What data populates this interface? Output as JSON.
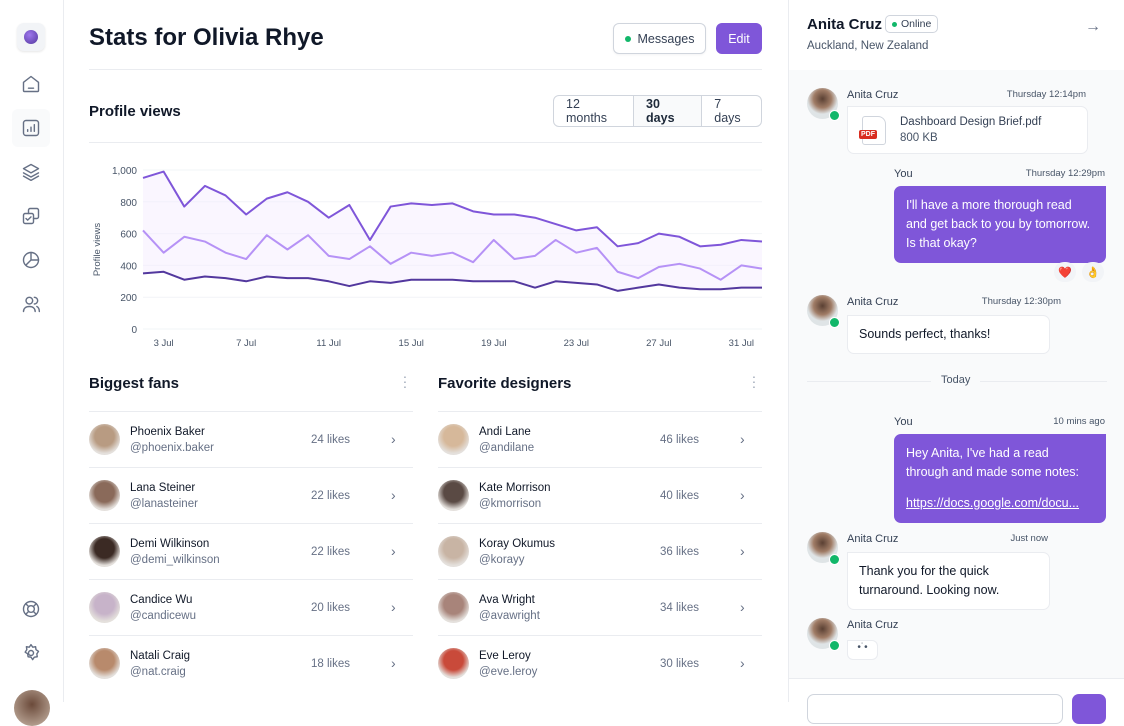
{
  "sidebar": {
    "items": [
      {
        "icon": "home-icon"
      },
      {
        "icon": "bar-chart-icon",
        "active": true
      },
      {
        "icon": "layers-icon"
      },
      {
        "icon": "check-square-icon"
      },
      {
        "icon": "pie-chart-icon"
      },
      {
        "icon": "users-icon"
      }
    ],
    "bottom": [
      {
        "icon": "life-buoy-icon"
      },
      {
        "icon": "settings-icon"
      }
    ]
  },
  "header": {
    "title": "Stats for Olivia Rhye",
    "messages_label": "Messages",
    "edit_label": "Edit"
  },
  "profile_views": {
    "title": "Profile views",
    "ranges": [
      "12 months",
      "30 days",
      "7 days"
    ],
    "selected_range": "30 days"
  },
  "chart_data": {
    "type": "line",
    "title": "",
    "xlabel": "",
    "ylabel": "Profile views",
    "ylim": [
      0,
      1000
    ],
    "yticks": [
      "0",
      "200",
      "400",
      "600",
      "800",
      "1,000"
    ],
    "xticks": [
      "3 Jul",
      "7 Jul",
      "11 Jul",
      "15 Jul",
      "19 Jul",
      "23 Jul",
      "27 Jul",
      "31 Jul"
    ],
    "grid": true,
    "colors": [
      "#7F56D9",
      "#B692F6",
      "#53389E"
    ],
    "x": [
      "2 Jul",
      "3 Jul",
      "4 Jul",
      "5 Jul",
      "6 Jul",
      "7 Jul",
      "8 Jul",
      "9 Jul",
      "10 Jul",
      "11 Jul",
      "12 Jul",
      "13 Jul",
      "14 Jul",
      "15 Jul",
      "16 Jul",
      "17 Jul",
      "18 Jul",
      "19 Jul",
      "20 Jul",
      "21 Jul",
      "22 Jul",
      "23 Jul",
      "24 Jul",
      "25 Jul",
      "26 Jul",
      "27 Jul",
      "28 Jul",
      "29 Jul",
      "30 Jul",
      "31 Jul",
      "1 Aug"
    ],
    "series": [
      {
        "values": [
          950,
          990,
          770,
          900,
          840,
          720,
          820,
          860,
          800,
          700,
          780,
          560,
          770,
          790,
          780,
          790,
          740,
          720,
          720,
          700,
          660,
          620,
          640,
          520,
          540,
          600,
          580,
          520,
          530,
          560,
          550
        ]
      },
      {
        "values": [
          620,
          480,
          580,
          550,
          480,
          440,
          590,
          500,
          590,
          460,
          440,
          520,
          410,
          480,
          460,
          480,
          420,
          560,
          440,
          460,
          560,
          480,
          510,
          360,
          320,
          390,
          410,
          380,
          310,
          400,
          380
        ]
      },
      {
        "values": [
          350,
          360,
          310,
          330,
          320,
          300,
          330,
          320,
          320,
          300,
          270,
          300,
          290,
          310,
          310,
          310,
          300,
          300,
          300,
          260,
          300,
          290,
          280,
          240,
          260,
          280,
          260,
          250,
          250,
          260,
          260
        ]
      }
    ]
  },
  "biggest_fans": {
    "title": "Biggest fans",
    "items": [
      {
        "name": "Phoenix Baker",
        "handle": "@phoenix.baker",
        "likes": "24 likes",
        "color": "#b89b82"
      },
      {
        "name": "Lana Steiner",
        "handle": "@lanasteiner",
        "likes": "22 likes",
        "color": "#8a6a5a"
      },
      {
        "name": "Demi Wilkinson",
        "handle": "@demi_wilkinson",
        "likes": "22 likes",
        "color": "#3b2a24"
      },
      {
        "name": "Candice Wu",
        "handle": "@candicewu",
        "likes": "20 likes",
        "color": "#c7b3c9"
      },
      {
        "name": "Natali Craig",
        "handle": "@nat.craig",
        "likes": "18 likes",
        "color": "#b88a6c"
      }
    ]
  },
  "favorite_designers": {
    "title": "Favorite designers",
    "items": [
      {
        "name": "Andi Lane",
        "handle": "@andilane",
        "likes": "46 likes",
        "color": "#d6b89a"
      },
      {
        "name": "Kate Morrison",
        "handle": "@kmorrison",
        "likes": "40 likes",
        "color": "#5a4a44"
      },
      {
        "name": "Koray Okumus",
        "handle": "@korayy",
        "likes": "36 likes",
        "color": "#c8b4a4"
      },
      {
        "name": "Ava Wright",
        "handle": "@avawright",
        "likes": "34 likes",
        "color": "#a8847a"
      },
      {
        "name": "Eve Leroy",
        "handle": "@eve.leroy",
        "likes": "30 likes",
        "color": "#c94a3a"
      }
    ]
  },
  "chat": {
    "name": "Anita Cruz",
    "status": "Online",
    "location": "Auckland, New Zealand",
    "m1": {
      "sender": "Anita Cruz",
      "time": "Thursday 12:14pm",
      "file_name": "Dashboard Design Brief.pdf",
      "file_size": "800 KB",
      "file_type": "PDF"
    },
    "m2": {
      "sender": "You",
      "time": "Thursday 12:29pm",
      "text": "I'll have a more thorough read and get back to you by tomorrow. Is that okay?",
      "reactions": [
        "❤️",
        "👌"
      ]
    },
    "m3": {
      "sender": "Anita Cruz",
      "time": "Thursday 12:30pm",
      "text": "Sounds perfect, thanks!"
    },
    "divider": "Today",
    "m4": {
      "sender": "You",
      "time": "10 mins ago",
      "text": "Hey Anita, I've had a read through and made some notes:",
      "link": "https://docs.google.com/docu..."
    },
    "m5": {
      "sender": "Anita Cruz",
      "time": "Just now",
      "text": "Thank you for the quick turnaround. Looking now."
    },
    "m6": {
      "sender": "Anita Cruz",
      "typing": "•˙•"
    }
  }
}
